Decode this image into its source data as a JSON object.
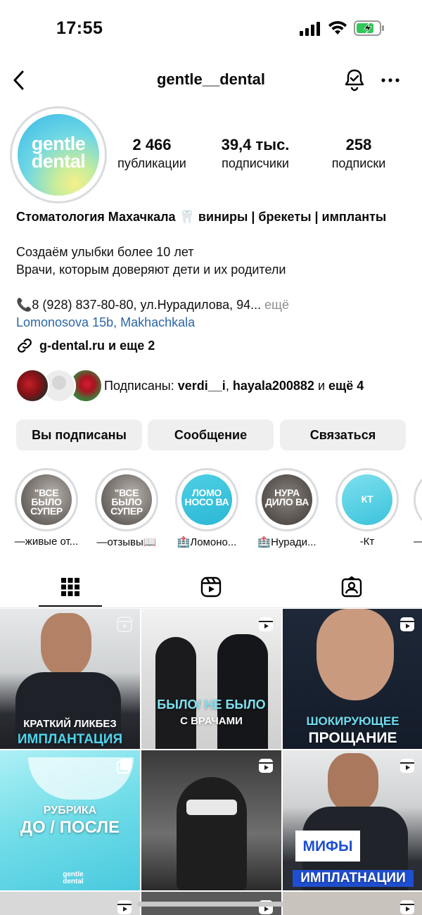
{
  "status_bar": {
    "time": "17:55"
  },
  "nav": {
    "username": "gentle__dental"
  },
  "profile": {
    "avatar_text_line1": "gentle",
    "avatar_text_line2": "dental",
    "stats": [
      {
        "value": "2 466",
        "label": "публикации"
      },
      {
        "value": "39,4 тыс.",
        "label": "подписчики"
      },
      {
        "value": "258",
        "label": "подписки"
      }
    ]
  },
  "bio": {
    "name": "Стоматология Махачкала 🦷 виниры | брекеты | импланты",
    "line1": "Создаём улыбки более 10 лет",
    "line2": "Врачи, которым доверяют дети и их родители",
    "contact": "📞8 (928) 837-80-80, ул.Нурадилова, 94...",
    "contact_more": "ещё",
    "location": "Lomonosova 15b, Makhachkala",
    "link": "g-dental.ru и еще 2"
  },
  "followed_by": {
    "prefix": "Подписаны:",
    "user1": "verdi__i",
    "separator": ",",
    "user2": "hayala200882",
    "suffix": "и",
    "more": "ещё 4"
  },
  "buttons": {
    "following": "Вы подписаны",
    "message": "Сообщение",
    "contact": "Связаться"
  },
  "highlights": [
    {
      "cover": "\"ВСЕ БЫЛО СУПЕР",
      "label": "—живые от..."
    },
    {
      "cover": "\"ВСЕ БЫЛО СУПЕР",
      "label": "—отзывы📖"
    },
    {
      "cover": "ЛОМО НОСО ВА",
      "label": "🏥Ломоно..."
    },
    {
      "cover": "НУРА ДИЛО ВА",
      "label": "🏥Нуради..."
    },
    {
      "cover": "КТ",
      "label": "-Кт"
    },
    {
      "cover": "",
      "label": "—"
    }
  ],
  "tabs": [
    "grid-icon",
    "reels-icon",
    "tagged-icon"
  ],
  "posts": [
    {
      "line1": "КРАТКИЙ ЛИКБЕЗ",
      "line2": "ИМПЛАНТАЦИЯ"
    },
    {
      "line1": "БЫЛО/ НЕ БЫЛО",
      "line2": "С ВРАЧАМИ"
    },
    {
      "line1": "ШОКИРУЮЩЕЕ",
      "line2": "ПРОЩАНИЕ"
    },
    {
      "line1": "РУБРИКА",
      "line2": "ДО / ПОСЛЕ",
      "watermark": "gentle dental"
    },
    {
      "line1": "",
      "line2": ""
    },
    {
      "line1": "МИФЫ",
      "line2": "ИМПЛАТНАЦИИ"
    }
  ],
  "colors": {
    "link_blue": "#2a66a8",
    "button_bg": "#efefef",
    "muted": "#8e8e8e",
    "brand_cyan": "#35b7e8"
  }
}
